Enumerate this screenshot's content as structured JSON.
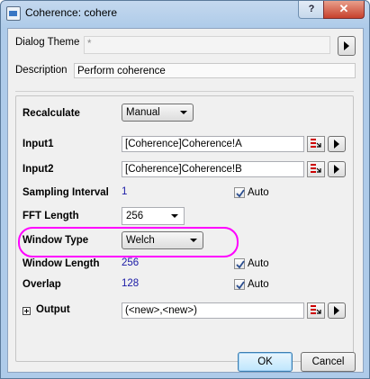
{
  "window": {
    "title": "Coherence: cohere",
    "help_label": "?",
    "close_label": "✕"
  },
  "dialog_theme": {
    "label": "Dialog Theme",
    "value": "*"
  },
  "description": {
    "label": "Description",
    "value": "Perform coherence"
  },
  "recalculate": {
    "label": "Recalculate",
    "value": "Manual"
  },
  "input1": {
    "label": "Input1",
    "value": "[Coherence]Coherence!A"
  },
  "input2": {
    "label": "Input2",
    "value": "[Coherence]Coherence!B"
  },
  "sampling_interval": {
    "label": "Sampling Interval",
    "value": "1",
    "auto_label": "Auto",
    "auto_checked": true
  },
  "fft_length": {
    "label": "FFT Length",
    "value": "256"
  },
  "window_type": {
    "label": "Window Type",
    "value": "Welch"
  },
  "window_length": {
    "label": "Window Length",
    "value": "256",
    "auto_label": "Auto",
    "auto_checked": true
  },
  "overlap": {
    "label": "Overlap",
    "value": "128",
    "auto_label": "Auto",
    "auto_checked": true
  },
  "output": {
    "label": "Output",
    "value": "(<new>,<new>)"
  },
  "buttons": {
    "ok": "OK",
    "cancel": "Cancel"
  },
  "colors": {
    "highlight": "#ff00ff",
    "value_blue": "#1a1aa6",
    "chrome": "#aecbe9"
  }
}
